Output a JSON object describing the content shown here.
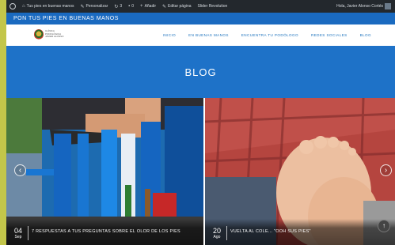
{
  "adminbar": {
    "site_name": "Tus pies en buenas manos",
    "customize": "Personalizar",
    "updates_count": "3",
    "comments_count": "0",
    "new": "Añadir",
    "edit_page": "Editar página",
    "slider_revolution": "Slider Revolution",
    "greeting": "Hola, Javier Alonso Cortés"
  },
  "site": {
    "title": "PON TUS PIES EN BUENAS MANOS"
  },
  "logo": {
    "text": "CLÍNICA PODOLÓGICA JAVIER ALONSO"
  },
  "nav": {
    "items": [
      "INICIO",
      "EN BUENAS MANOS",
      "ENCUENTRA TU PODÓLOGO",
      "REDES SOCIALES",
      "BLOG"
    ]
  },
  "banner": {
    "title": "BLOG"
  },
  "posts": [
    {
      "day": "04",
      "month": "Sep",
      "title": "7 RESPUESTAS A TUS PREGUNTAS SOBRE EL OLOR DE LOS PIES"
    },
    {
      "day": "20",
      "month": "Ago",
      "title": "VUELTA AL COLE... \"OOH SUS PIES\""
    }
  ],
  "icons": {
    "wp": "wordpress-icon",
    "prev": "chevron-left-icon",
    "next": "chevron-right-icon",
    "top": "arrow-up-icon"
  },
  "colors": {
    "admin_bar": "#23282d",
    "brand_blue": "#1e72c8",
    "frame": "#c3c64a"
  }
}
